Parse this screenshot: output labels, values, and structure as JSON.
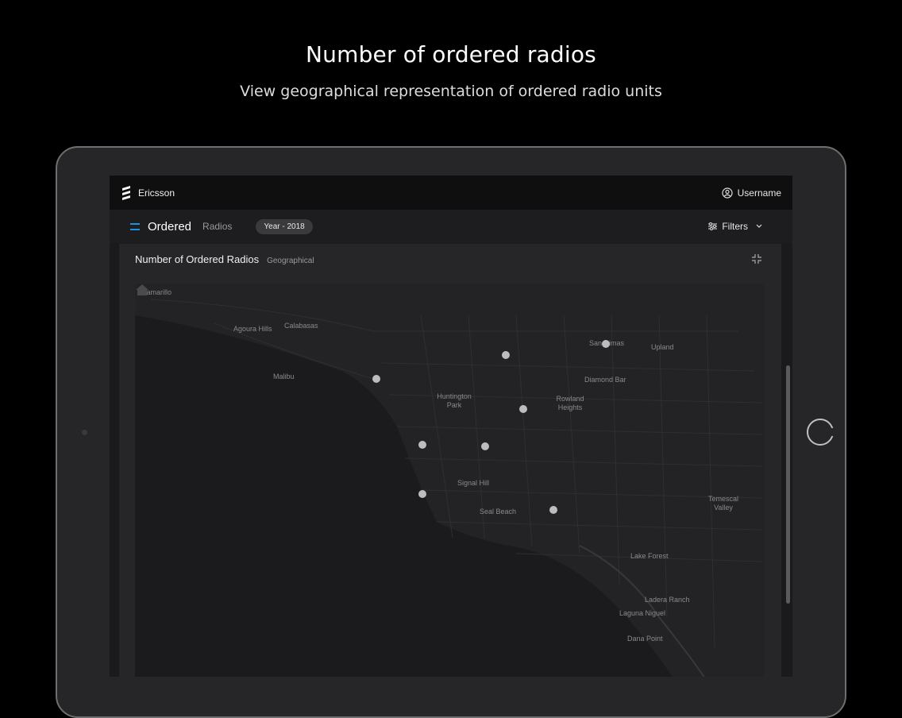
{
  "hero": {
    "title": "Number of ordered radios",
    "subtitle": "View geographical representation of ordered radio units"
  },
  "app": {
    "brand": "Ericsson",
    "user": "Username",
    "page_title": "Ordered",
    "page_subtitle": "Radios",
    "year_pill": "Year - 2018",
    "filters_label": "Filters"
  },
  "card": {
    "title": "Number of Ordered Radios",
    "subtitle": "Geographical"
  },
  "map": {
    "cities": [
      {
        "name": "Camarillo"
      },
      {
        "name": "Agoura Hills"
      },
      {
        "name": "Calabasas"
      },
      {
        "name": "Malibu"
      },
      {
        "name": "San Dimas"
      },
      {
        "name": "Upland"
      },
      {
        "name": "Diamond Bar"
      },
      {
        "name": "Huntington Park"
      },
      {
        "name": "Rowland Heights"
      },
      {
        "name": "Signal Hill"
      },
      {
        "name": "Seal Beach"
      },
      {
        "name": "Temescal Valley"
      },
      {
        "name": "Lake Forest"
      },
      {
        "name": "Ladera Ranch"
      },
      {
        "name": "Laguna Niguel"
      },
      {
        "name": "Dana Point"
      }
    ],
    "markers": [
      {
        "name": "marker-1"
      },
      {
        "name": "marker-2"
      },
      {
        "name": "marker-3"
      },
      {
        "name": "marker-4"
      },
      {
        "name": "marker-5"
      },
      {
        "name": "marker-6"
      },
      {
        "name": "marker-7"
      },
      {
        "name": "marker-8"
      }
    ]
  },
  "icons": {
    "brand": "ericsson-logo-icon",
    "user": "user-circle-icon",
    "menu": "menu-icon",
    "filters": "sliders-icon",
    "chevron": "chevron-down-icon",
    "collapse": "collapse-icon",
    "home": "home-icon"
  },
  "colors": {
    "accent": "#1f8fe0",
    "background": "#000000",
    "marker": "#bdbdbd"
  }
}
